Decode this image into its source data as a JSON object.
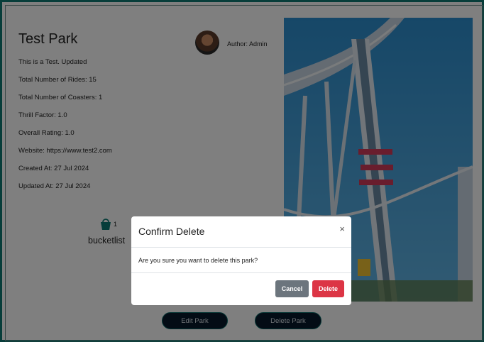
{
  "park": {
    "title": "Test Park",
    "author": "Author: Admin",
    "description": "This is a Test. Updated",
    "total_rides": "Total Number of Rides: 15",
    "total_coasters": "Total Number of Coasters: 1",
    "thrill_factor": "Thrill Factor: 1.0",
    "overall_rating": "Overall Rating: 1.0",
    "website": "Website: https://www.test2.com",
    "created_at": "Created At: 27 Jul 2024",
    "updated_at": "Updated At: 27 Jul 2024"
  },
  "bucketlist": {
    "count": "1",
    "label": "bucketlist",
    "icon": "bucket-icon",
    "icon_color": "#0f7a74"
  },
  "actions": {
    "edit_label": "Edit Park",
    "delete_label": "Delete Park"
  },
  "modal": {
    "title": "Confirm Delete",
    "close_glyph": "×",
    "body": "Are you sure you want to delete this park?",
    "cancel_label": "Cancel",
    "delete_label": "Delete"
  },
  "colors": {
    "frame_border": "#0f7a74",
    "button_dark": "#07182a",
    "cancel": "#6c757d",
    "danger": "#dc3545"
  }
}
